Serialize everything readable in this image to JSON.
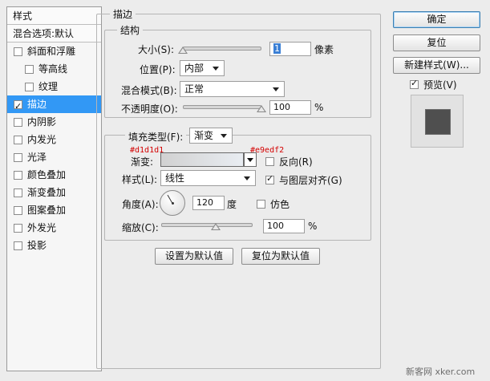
{
  "left_panel": {
    "header": "样式",
    "blend_options": "混合选项:默认",
    "items": [
      {
        "label": "斜面和浮雕",
        "checked": false
      },
      {
        "label": "等高线",
        "checked": false,
        "sub": true
      },
      {
        "label": "纹理",
        "checked": false,
        "sub": true
      },
      {
        "label": "描边",
        "checked": true,
        "active": true
      },
      {
        "label": "内阴影",
        "checked": false
      },
      {
        "label": "内发光",
        "checked": false
      },
      {
        "label": "光泽",
        "checked": false
      },
      {
        "label": "颜色叠加",
        "checked": false
      },
      {
        "label": "渐变叠加",
        "checked": false
      },
      {
        "label": "图案叠加",
        "checked": false
      },
      {
        "label": "外发光",
        "checked": false
      },
      {
        "label": "投影",
        "checked": false
      }
    ]
  },
  "stroke": {
    "title": "描边",
    "structure": {
      "title": "结构",
      "size_label": "大小(S):",
      "size_value": "1",
      "size_unit": "像素",
      "position_label": "位置(P):",
      "position_value": "内部",
      "blend_label": "混合模式(B):",
      "blend_value": "正常",
      "opacity_label": "不透明度(O):",
      "opacity_value": "100",
      "opacity_unit": "%"
    },
    "fill": {
      "type_label": "填充类型(F):",
      "type_value": "渐变",
      "gradient_label": "渐变:",
      "gradient_start_hex": "#d1d1d1",
      "gradient_end_hex": "#e9edf2",
      "reverse_label": "反向(R)",
      "style_label": "样式(L):",
      "style_value": "线性",
      "align_label": "与图层对齐(G)",
      "angle_label": "角度(A):",
      "angle_value": "120",
      "angle_unit": "度",
      "dither_label": "仿色",
      "scale_label": "缩放(C):",
      "scale_value": "100",
      "scale_unit": "%"
    },
    "make_default": "设置为默认值",
    "reset_default": "复位为默认值"
  },
  "buttons": {
    "ok": "确定",
    "reset": "复位",
    "new_style": "新建样式(W)...",
    "preview_label": "预览(V)"
  },
  "watermark": "新客网 xker.com",
  "colors": {
    "accent": "#3298f5",
    "preview_swatch": "#4f4f4f"
  }
}
